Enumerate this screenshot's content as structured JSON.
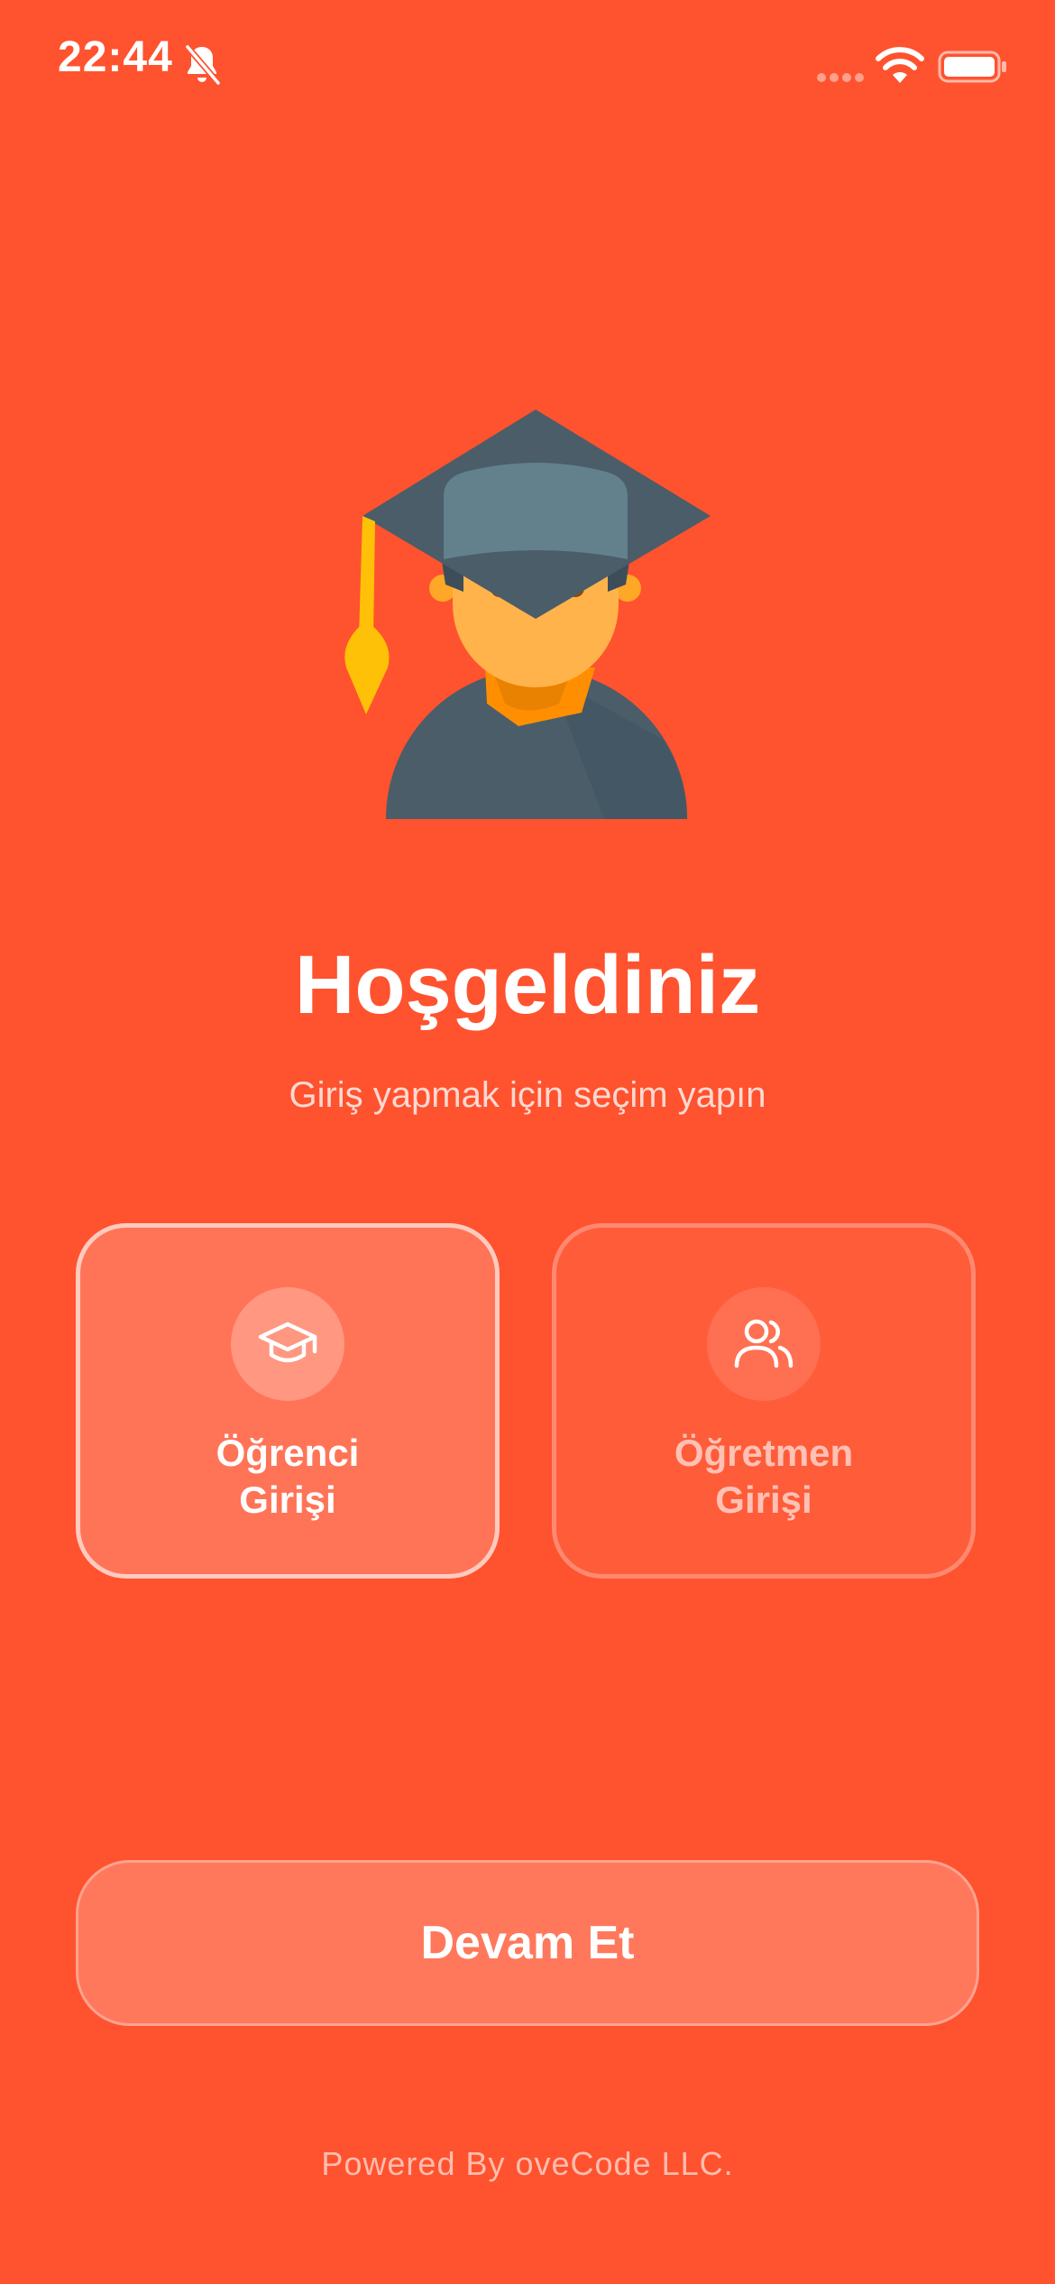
{
  "status_bar": {
    "time": "22:44",
    "icons": [
      "bell-slash-icon",
      "cellular-signal-icon",
      "wifi-icon",
      "battery-icon"
    ]
  },
  "illustration": {
    "icon": "graduate-student-icon"
  },
  "welcome": {
    "title": "Hoşgeldiniz",
    "subtitle": "Giriş yapmak için seçim yapın"
  },
  "roles": [
    {
      "id": "student",
      "icon": "graduation-cap-icon",
      "label_line1": "Öğrenci",
      "label_line2": "Girişi",
      "selected": true
    },
    {
      "id": "teacher",
      "icon": "users-icon",
      "label_line1": "Öğretmen",
      "label_line2": "Girişi",
      "selected": false
    }
  ],
  "continue_button": {
    "label": "Devam Et"
  },
  "footer": {
    "text": "Powered By oveCode LLC."
  },
  "colors": {
    "background": "#FF522E",
    "text": "#FFFFFF",
    "cap_dark": "#4A5D69",
    "cap_band": "#63808D",
    "skin": "#FFB34A",
    "tassel": "#FFC107",
    "scarf": "#FF8F00"
  }
}
